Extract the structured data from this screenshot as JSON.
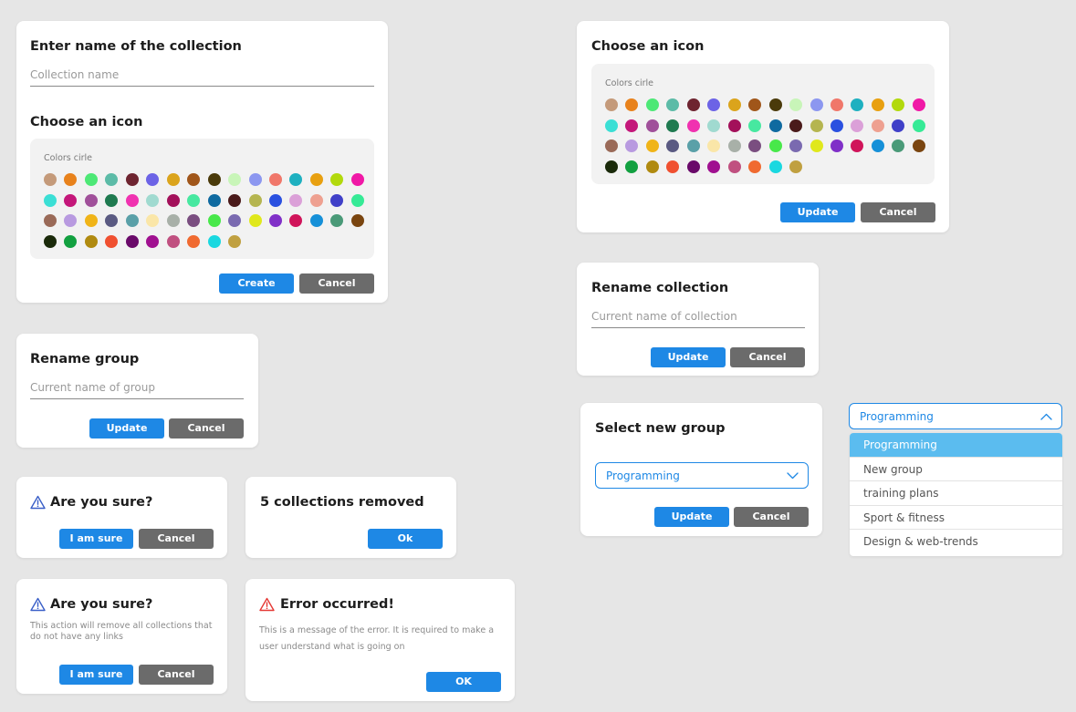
{
  "colors": {
    "primary": "#1e88e5",
    "secondary": "#6b6b6b",
    "dropdown_active": "#5bbcef",
    "warning": "#3a5fc8",
    "error": "#e53935"
  },
  "palette_colors": [
    "#c49a7a",
    "#e8821c",
    "#4de876",
    "#5cbba7",
    "#6e2430",
    "#6c63e6",
    "#dba41c",
    "#a0561a",
    "#4a3a0a",
    "#c8f5b8",
    "#8c97f0",
    "#f0776a",
    "#1eb0c0",
    "#e8a010",
    "#b2d90c",
    "#f019a6",
    "#3bdfd5",
    "#c4177a",
    "#a0509a",
    "#1f7a50",
    "#f032b0",
    "#a0dad0",
    "#a3105a",
    "#47e8a0",
    "#0f6aa0",
    "#4a1a1a",
    "#b5b550",
    "#2a50e0",
    "#dba0d8",
    "#eea090",
    "#4040c8",
    "#36ea96",
    "#9a6a58",
    "#b89ae0",
    "#f0b418",
    "#5a5a82",
    "#5aa0a8",
    "#fae6a8",
    "#a8b0a8",
    "#7a4e80",
    "#48e84a",
    "#7a6ab0",
    "#e0e81c",
    "#8030c8",
    "#d0145a",
    "#1690d8",
    "#4a9a78",
    "#7a4510",
    "#1a2a0a",
    "#12a040",
    "#b08a10",
    "#f05030",
    "#6a0a6a",
    "#a01090",
    "#c05080",
    "#f06a30",
    "#1ad8e0",
    "#c0a040"
  ],
  "create_dialog": {
    "title": "Enter name of the collection",
    "name_placeholder": "Collection name",
    "icon_title": "Choose an icon",
    "palette_label": "Colors cirle",
    "create_label": "Create",
    "cancel_label": "Cancel"
  },
  "icon_dialog": {
    "title": "Choose an icon",
    "palette_label": "Colors cirle",
    "update_label": "Update",
    "cancel_label": "Cancel"
  },
  "rename_group_dialog": {
    "title": "Rename group",
    "placeholder": "Current name of group",
    "update_label": "Update",
    "cancel_label": "Cancel"
  },
  "rename_collection_dialog": {
    "title": "Rename collection",
    "placeholder": "Current name of collection",
    "update_label": "Update",
    "cancel_label": "Cancel"
  },
  "confirm_dialog": {
    "title": "Are you sure?",
    "confirm_label": "I am sure",
    "cancel_label": "Cancel"
  },
  "removed_dialog": {
    "title": "5 collections removed",
    "ok_label": "Ok"
  },
  "confirm_detail_dialog": {
    "title": "Are you sure?",
    "message": "This action will remove all collections that do not have any links",
    "confirm_label": "I am sure",
    "cancel_label": "Cancel"
  },
  "error_dialog": {
    "title": "Error occurred!",
    "message": "This is a message of the error. It is required to make a user understand what is going on",
    "ok_label": "OK"
  },
  "select_group_dialog": {
    "title": "Select new group",
    "selected": "Programming",
    "update_label": "Update",
    "cancel_label": "Cancel"
  },
  "group_dropdown": {
    "selected": "Programming",
    "options": [
      "Programming",
      "New group",
      "training plans",
      "Sport & fitness",
      "Design & web-trends"
    ]
  }
}
